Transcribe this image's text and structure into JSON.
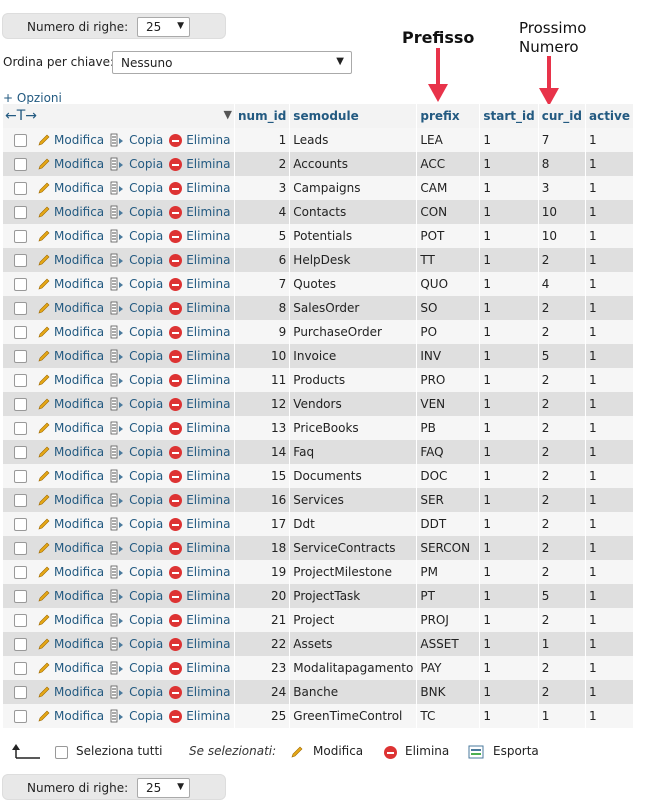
{
  "pagination": {
    "rows_label": "Numero di righe:",
    "rows_value": "25"
  },
  "order": {
    "label": "Ordina per chiave:",
    "value": "Nessuno"
  },
  "options_link": "+ Opzioni",
  "annotations": {
    "prefix": "Prefisso",
    "next_line1": "Prossimo",
    "next_line2": "Numero",
    "arrow_color": "#e8334a"
  },
  "actions": {
    "edit": "Modifica",
    "copy": "Copia",
    "delete": "Elimina"
  },
  "columns": [
    "num_id",
    "semodule",
    "prefix",
    "start_id",
    "cur_id",
    "active"
  ],
  "rows": [
    {
      "num_id": "1",
      "semodule": "Leads",
      "prefix": "LEA",
      "start_id": "1",
      "cur_id": "7",
      "active": "1"
    },
    {
      "num_id": "2",
      "semodule": "Accounts",
      "prefix": "ACC",
      "start_id": "1",
      "cur_id": "8",
      "active": "1"
    },
    {
      "num_id": "3",
      "semodule": "Campaigns",
      "prefix": "CAM",
      "start_id": "1",
      "cur_id": "3",
      "active": "1"
    },
    {
      "num_id": "4",
      "semodule": "Contacts",
      "prefix": "CON",
      "start_id": "1",
      "cur_id": "10",
      "active": "1"
    },
    {
      "num_id": "5",
      "semodule": "Potentials",
      "prefix": "POT",
      "start_id": "1",
      "cur_id": "10",
      "active": "1"
    },
    {
      "num_id": "6",
      "semodule": "HelpDesk",
      "prefix": "TT",
      "start_id": "1",
      "cur_id": "2",
      "active": "1"
    },
    {
      "num_id": "7",
      "semodule": "Quotes",
      "prefix": "QUO",
      "start_id": "1",
      "cur_id": "4",
      "active": "1"
    },
    {
      "num_id": "8",
      "semodule": "SalesOrder",
      "prefix": "SO",
      "start_id": "1",
      "cur_id": "2",
      "active": "1"
    },
    {
      "num_id": "9",
      "semodule": "PurchaseOrder",
      "prefix": "PO",
      "start_id": "1",
      "cur_id": "2",
      "active": "1"
    },
    {
      "num_id": "10",
      "semodule": "Invoice",
      "prefix": "INV",
      "start_id": "1",
      "cur_id": "5",
      "active": "1"
    },
    {
      "num_id": "11",
      "semodule": "Products",
      "prefix": "PRO",
      "start_id": "1",
      "cur_id": "2",
      "active": "1"
    },
    {
      "num_id": "12",
      "semodule": "Vendors",
      "prefix": "VEN",
      "start_id": "1",
      "cur_id": "2",
      "active": "1"
    },
    {
      "num_id": "13",
      "semodule": "PriceBooks",
      "prefix": "PB",
      "start_id": "1",
      "cur_id": "2",
      "active": "1"
    },
    {
      "num_id": "14",
      "semodule": "Faq",
      "prefix": "FAQ",
      "start_id": "1",
      "cur_id": "2",
      "active": "1"
    },
    {
      "num_id": "15",
      "semodule": "Documents",
      "prefix": "DOC",
      "start_id": "1",
      "cur_id": "2",
      "active": "1"
    },
    {
      "num_id": "16",
      "semodule": "Services",
      "prefix": "SER",
      "start_id": "1",
      "cur_id": "2",
      "active": "1"
    },
    {
      "num_id": "17",
      "semodule": "Ddt",
      "prefix": "DDT",
      "start_id": "1",
      "cur_id": "2",
      "active": "1"
    },
    {
      "num_id": "18",
      "semodule": "ServiceContracts",
      "prefix": "SERCON",
      "start_id": "1",
      "cur_id": "2",
      "active": "1"
    },
    {
      "num_id": "19",
      "semodule": "ProjectMilestone",
      "prefix": "PM",
      "start_id": "1",
      "cur_id": "2",
      "active": "1"
    },
    {
      "num_id": "20",
      "semodule": "ProjectTask",
      "prefix": "PT",
      "start_id": "1",
      "cur_id": "5",
      "active": "1"
    },
    {
      "num_id": "21",
      "semodule": "Project",
      "prefix": "PROJ",
      "start_id": "1",
      "cur_id": "2",
      "active": "1"
    },
    {
      "num_id": "22",
      "semodule": "Assets",
      "prefix": "ASSET",
      "start_id": "1",
      "cur_id": "1",
      "active": "1"
    },
    {
      "num_id": "23",
      "semodule": "Modalitapagamento",
      "prefix": "PAY",
      "start_id": "1",
      "cur_id": "2",
      "active": "1"
    },
    {
      "num_id": "24",
      "semodule": "Banche",
      "prefix": "BNK",
      "start_id": "1",
      "cur_id": "2",
      "active": "1"
    },
    {
      "num_id": "25",
      "semodule": "GreenTimeControl",
      "prefix": "TC",
      "start_id": "1",
      "cur_id": "1",
      "active": "1"
    }
  ],
  "footer": {
    "select_all": "Seleziona tutti",
    "with_selected": "Se selezionati:",
    "edit": "Modifica",
    "delete": "Elimina",
    "export": "Esporta"
  }
}
